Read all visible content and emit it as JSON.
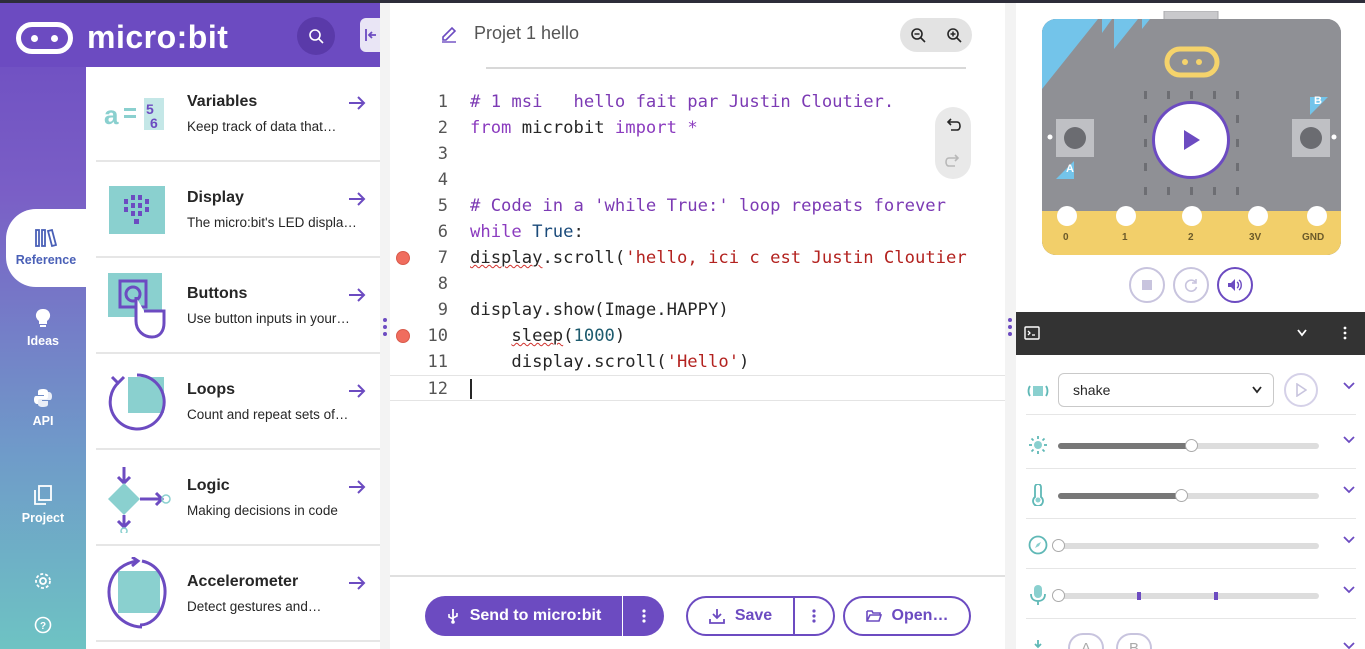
{
  "app": {
    "logo_text": "micro:bit"
  },
  "nav": {
    "items": [
      {
        "label": "Reference"
      },
      {
        "label": "Ideas"
      },
      {
        "label": "API"
      },
      {
        "label": "Project"
      }
    ]
  },
  "reference": {
    "cards": [
      {
        "title": "Variables",
        "desc": "Keep track of data that…"
      },
      {
        "title": "Display",
        "desc": "The micro:bit's LED displa…"
      },
      {
        "title": "Buttons",
        "desc": "Use button inputs in your…"
      },
      {
        "title": "Loops",
        "desc": "Count and repeat sets of…"
      },
      {
        "title": "Logic",
        "desc": "Making decisions in code"
      },
      {
        "title": "Accelerometer",
        "desc": "Detect gestures and…"
      }
    ]
  },
  "editor": {
    "project_name": "Projet 1 hello",
    "line_numbers": [
      "1",
      "2",
      "3",
      "4",
      "5",
      "6",
      "7",
      "8",
      "9",
      "10",
      "11",
      "12"
    ],
    "code": {
      "l1": "# 1 msi   hello fait par Justin Cloutier.",
      "l2_kw1": "from",
      "l2_mod": " microbit ",
      "l2_kw2": "import",
      "l2_star": " *",
      "l5": "# Code in a 'while True:' loop repeats forever",
      "l6_kw": "while",
      "l6_true": " True",
      "l6_colon": ":",
      "l7_fn": "display",
      "l7_rest": ".scroll(",
      "l7_str": "'hello, ici c est Justin Cloutier",
      "l9": "display.show(Image.HAPPY)",
      "l10_indent": "    ",
      "l10_fn": "sleep",
      "l10_open": "(",
      "l10_num": "1000",
      "l10_close": ")",
      "l11_pre": "    display.scroll(",
      "l11_str": "'Hello'",
      "l11_close": ")"
    }
  },
  "actions": {
    "send_label": "Send to micro:bit",
    "save_label": "Save",
    "open_label": "Open…"
  },
  "simulator": {
    "pins": [
      "0",
      "1",
      "2",
      "3V",
      "GND"
    ],
    "button_a": "A",
    "button_b": "B",
    "gesture_selected": "shake",
    "sensors": {
      "light_level": 0.51,
      "temperature_level": 0.47,
      "compass_level": 0.0,
      "sound_level": 0.0
    },
    "accent": "#6c4bc1"
  }
}
